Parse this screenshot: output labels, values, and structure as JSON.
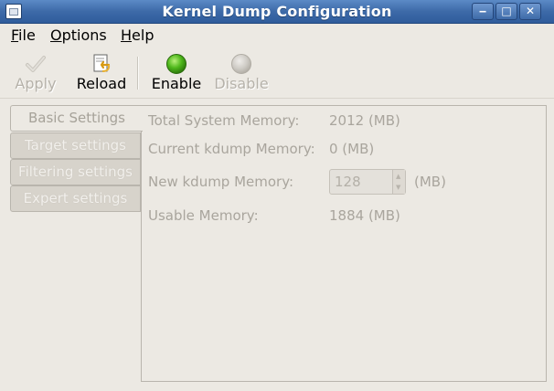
{
  "window": {
    "title": "Kernel Dump Configuration",
    "controls": {
      "minimize": "‒",
      "maximize": "□",
      "close": "✕"
    }
  },
  "menu": {
    "file": {
      "mnemonic": "F",
      "rest": "ile"
    },
    "options": {
      "mnemonic": "O",
      "rest": "ptions"
    },
    "help": {
      "mnemonic": "H",
      "rest": "elp"
    }
  },
  "toolbar": {
    "apply_label": "Apply",
    "reload_label": "Reload",
    "enable_label": "Enable",
    "disable_label": "Disable"
  },
  "tabs": [
    {
      "label": "Basic Settings",
      "active": true
    },
    {
      "label": "Target settings",
      "active": false
    },
    {
      "label": "Filtering settings",
      "active": false
    },
    {
      "label": "Expert settings",
      "active": false
    }
  ],
  "basic": {
    "total_memory_label": "Total System Memory:",
    "total_memory_value": "2012 (MB)",
    "current_kdump_label": "Current kdump Memory:",
    "current_kdump_value": "0 (MB)",
    "new_kdump_label": "New kdump Memory:",
    "new_kdump_value": "128",
    "new_kdump_unit": "(MB)",
    "usable_memory_label": "Usable Memory:",
    "usable_memory_value": "1884 (MB)"
  },
  "colors": {
    "titlebar": "#3d6aa8",
    "window_bg": "#ece9e3",
    "disabled_text": "#a9a59d",
    "enable_icon": "#3fa012"
  }
}
